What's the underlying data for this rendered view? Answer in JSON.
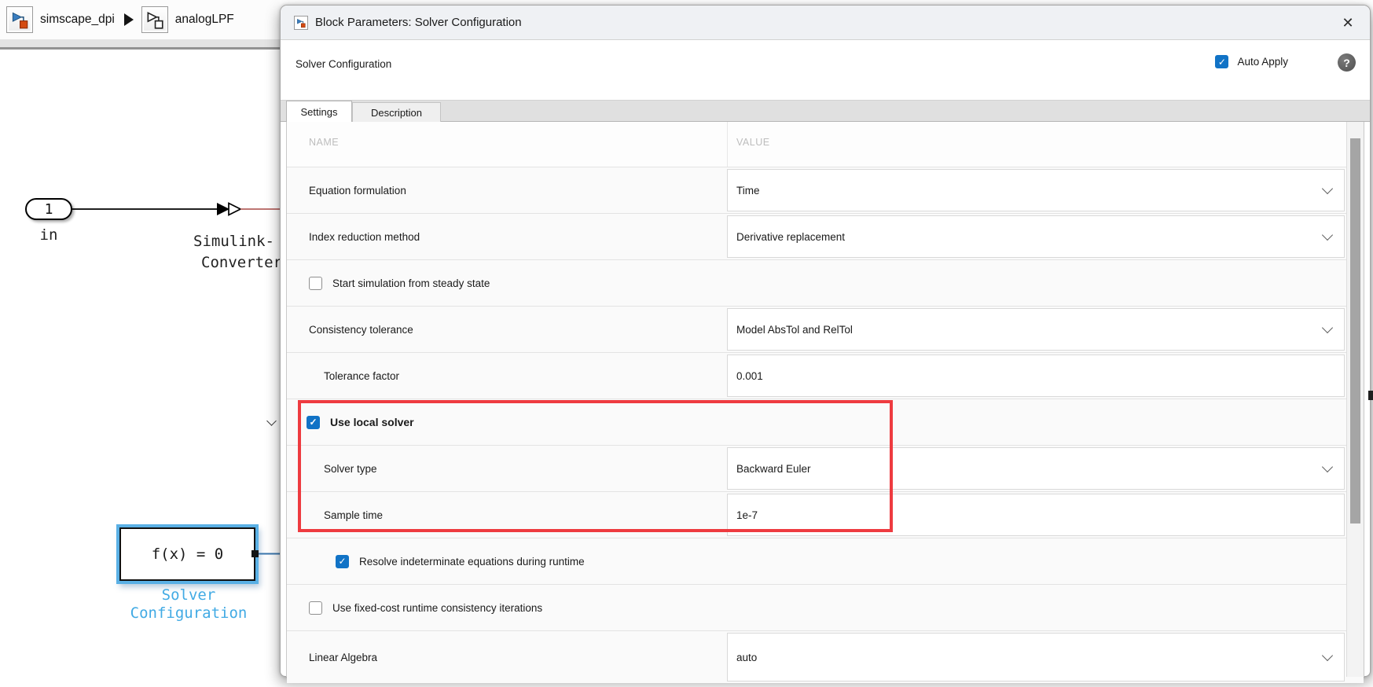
{
  "breadcrumb": {
    "separator_icon": "right-triangle",
    "items": [
      {
        "label": "simscape_dpi",
        "icon": "simulink-model-icon"
      },
      {
        "label": "analogLPF",
        "icon": "simulink-subsystem-icon"
      }
    ]
  },
  "canvas": {
    "inport_block": {
      "number": "1",
      "label": "in"
    },
    "converter_label": {
      "line1": "Simulink-",
      "line2": "Converter"
    },
    "solver_block": {
      "text": "f(x) = 0",
      "label_line1": "Solver",
      "label_line2": "Configuration"
    },
    "colors": {
      "selection_blue": "#5ab0e5",
      "label_blue": "#41aae4",
      "wire_red": "#b4625f",
      "wire_blue": "#3a76ad"
    }
  },
  "dialog": {
    "title": "Block Parameters: Solver Configuration",
    "title_icon": "simulink-model-icon",
    "close_icon": "✕",
    "subtitle": "Solver Configuration",
    "auto_apply": {
      "label": "Auto Apply",
      "checked": true
    },
    "help_icon": "?",
    "tabs": [
      {
        "label": "Settings",
        "active": true
      },
      {
        "label": "Description",
        "active": false
      }
    ],
    "table": {
      "columns": {
        "name": "NAME",
        "value": "VALUE"
      },
      "rows": [
        {
          "name": "Equation formulation",
          "value": "Time",
          "control": "dropdown"
        },
        {
          "name": "Index reduction method",
          "value": "Derivative replacement",
          "control": "dropdown"
        },
        {
          "name": "Start simulation from steady state",
          "control": "checkbox",
          "checked": false
        },
        {
          "name": "Consistency tolerance",
          "value": "Model AbsTol and RelTol",
          "control": "dropdown"
        },
        {
          "name": "Tolerance factor",
          "value": "0.001",
          "control": "textfield"
        },
        {
          "name": "Use local solver",
          "control": "section-checkbox",
          "checked": true,
          "collapsible": true
        },
        {
          "name": "Solver type",
          "value": "Backward Euler",
          "control": "dropdown"
        },
        {
          "name": "Sample time",
          "value": "1e-7",
          "control": "textfield"
        },
        {
          "name": "Resolve indeterminate equations during runtime",
          "control": "checkbox",
          "checked": true
        },
        {
          "name": "Use fixed-cost runtime consistency iterations",
          "control": "checkbox",
          "checked": false
        },
        {
          "name": "Linear Algebra",
          "value": "auto",
          "control": "dropdown"
        }
      ],
      "highlight_box": {
        "color": "#ee3b40",
        "rows": [
          "Use local solver",
          "Solver type",
          "Sample time"
        ]
      }
    },
    "accent_color": "#1173c6"
  }
}
